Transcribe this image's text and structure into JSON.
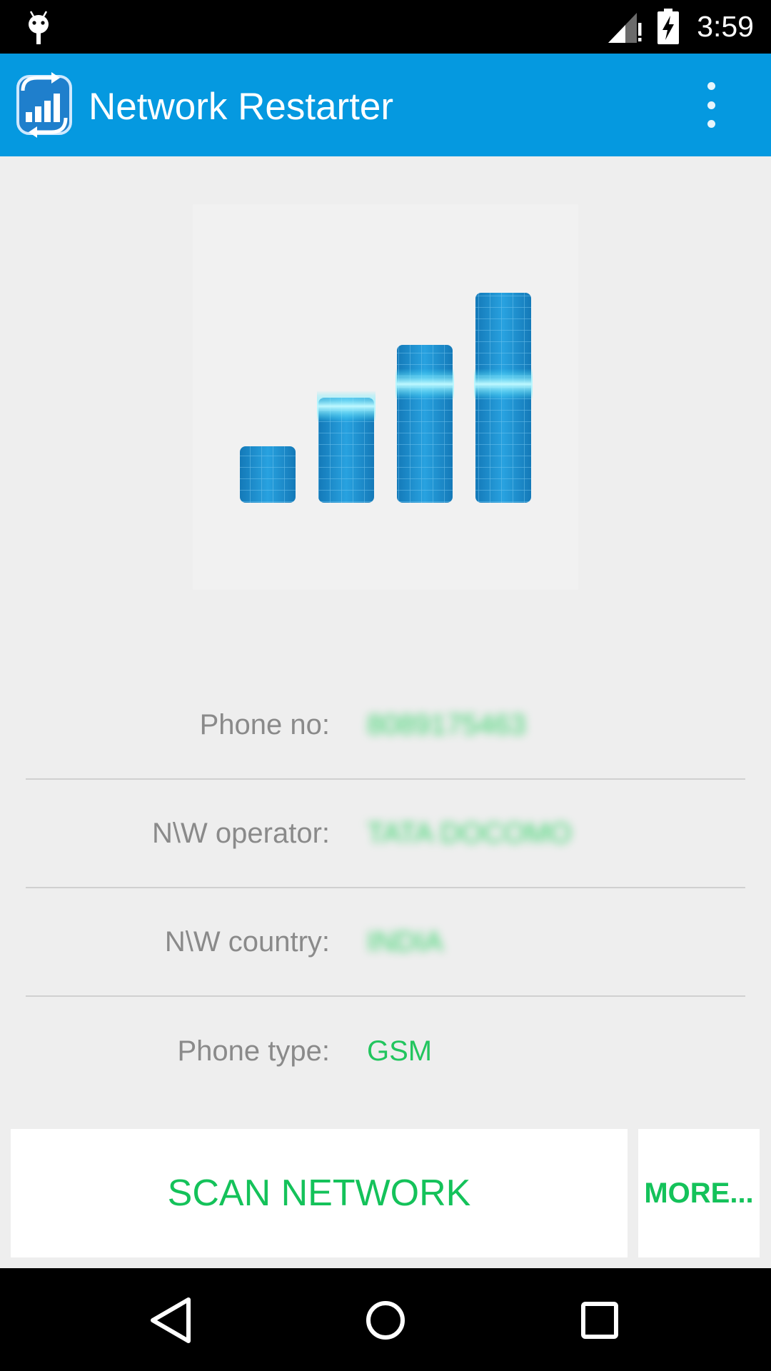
{
  "status_bar": {
    "time": "3:59",
    "icons": [
      "android-debug-icon",
      "signal-icon",
      "battery-charging-icon"
    ]
  },
  "app_bar": {
    "title": "Network Restarter",
    "icons": [
      "app-logo-icon",
      "overflow-menu-icon"
    ]
  },
  "hero": {
    "icon": "signal-bars-icon",
    "bar_levels": [
      0.27,
      0.5,
      0.75,
      1.0
    ]
  },
  "info": {
    "phone_no": {
      "label": "Phone no:",
      "value": "8089175463"
    },
    "operator": {
      "label": "N\\W operator:",
      "value": "TATA DOCOMO"
    },
    "country": {
      "label": "N\\W country:",
      "value": "INDIA"
    },
    "phone_type": {
      "label": "Phone type:",
      "value": "GSM"
    }
  },
  "buttons": {
    "scan_label": "SCAN NETWORK",
    "more_label": "MORE..."
  },
  "nav_bar": {
    "icons": [
      "back-icon",
      "home-icon",
      "recents-icon"
    ]
  },
  "colors": {
    "app_bar": "#0599e0",
    "accent_green": "#14c25a",
    "background": "#eeeeee",
    "bar_blue": "#1a8fcf",
    "bar_glow": "#3ee6ff"
  }
}
